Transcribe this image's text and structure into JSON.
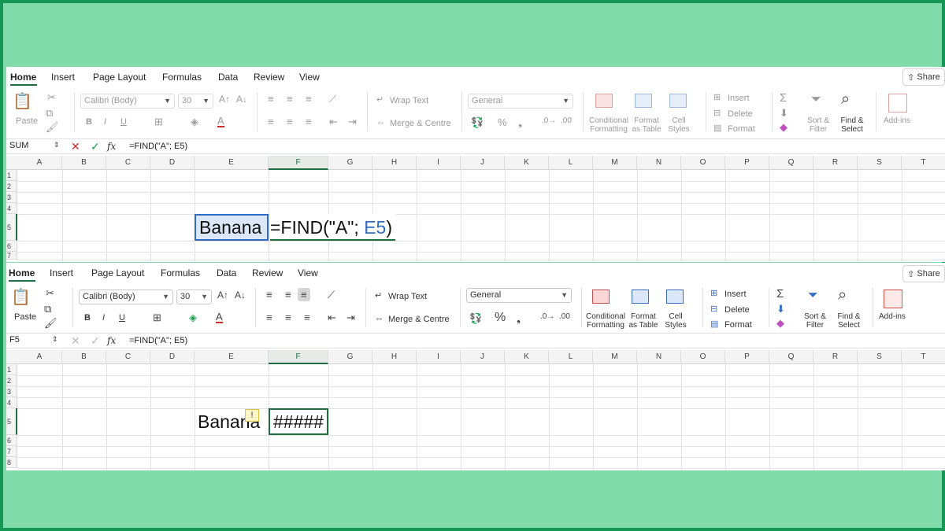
{
  "tabs": [
    "Home",
    "Insert",
    "Page Layout",
    "Formulas",
    "Data",
    "Review",
    "View"
  ],
  "share_label": "Share",
  "ribbon": {
    "paste": "Paste",
    "font_name": "Calibri (Body)",
    "font_size": "30",
    "bold": "B",
    "italic": "I",
    "underline": "U",
    "wrap_text": "Wrap Text",
    "merge_centre": "Merge & Centre",
    "number_format": "General",
    "conditional_formatting": [
      "Conditional",
      "Formatting"
    ],
    "format_as_table": [
      "Format",
      "as Table"
    ],
    "cell_styles": [
      "Cell",
      "Styles"
    ],
    "insert": "Insert",
    "delete": "Delete",
    "format": "Format",
    "sort_filter": [
      "Sort &",
      "Filter"
    ],
    "find_select": [
      "Find &",
      "Select"
    ],
    "add_ins": "Add-ins"
  },
  "columns": [
    "A",
    "B",
    "C",
    "D",
    "E",
    "F",
    "G",
    "H",
    "I",
    "J",
    "K",
    "L",
    "M",
    "N",
    "O",
    "P",
    "Q",
    "R",
    "S",
    "T"
  ],
  "panel1": {
    "name_box": "SUM",
    "formula": "=FIND(\"A\"; E5)",
    "rows": [
      "1",
      "2",
      "3",
      "4",
      "5",
      "6",
      "7"
    ],
    "cell_e5": "Banana",
    "cell_f5_prefix": "=FIND(\"A\"; ",
    "cell_f5_ref": "E5",
    "cell_f5_suffix": ")"
  },
  "panel2": {
    "name_box": "F5",
    "formula": "=FIND(\"A\"; E5)",
    "rows": [
      "1",
      "2",
      "3",
      "4",
      "5",
      "6",
      "7",
      "8"
    ],
    "cell_e5": "Banana",
    "cell_f5": "#####",
    "warning_symbol": "!"
  },
  "colors": {
    "background": "#82dbab",
    "border": "#159655",
    "excel_green": "#1d6f42",
    "ref_blue": "#2f6cc0",
    "cancel_red": "#d22b2b",
    "enter_green": "#1f9e4a"
  }
}
